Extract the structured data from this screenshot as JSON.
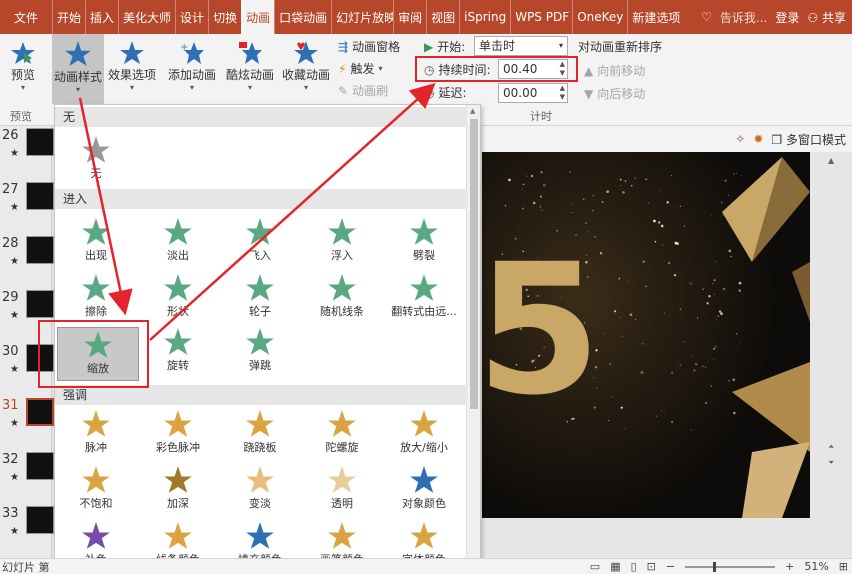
{
  "tabs": [
    "文件",
    "开始",
    "插入",
    "美化大师",
    "设计",
    "切换",
    "动画",
    "口袋动画",
    "幻灯片放映",
    "审阅",
    "视图",
    "iSpring",
    "WPS PDF",
    "OneKey",
    "新建选项"
  ],
  "active_tab": "动画",
  "tellme": "告诉我...",
  "login": "登录",
  "share": "共享",
  "ribbon": {
    "preview": "预览",
    "preview_group": "预览",
    "anim_style": "动画样式",
    "effect_options": "效果选项",
    "add_anim": "添加动画",
    "cool_anim": "酷炫动画",
    "fav_anim": "收藏动画",
    "anim_pane": "动画窗格",
    "trigger": "触发",
    "anim_brush": "动画刷",
    "start_label": "开始:",
    "start_value": "单击时",
    "duration_label": "持续时间:",
    "duration_value": "00.40",
    "delay_label": "延迟:",
    "delay_value": "00.00",
    "reorder": "对动画重新排序",
    "move_earlier": "向前移动",
    "move_later": "向后移动",
    "timing_group": "计时"
  },
  "toolstrip": {
    "multiwindow": "多窗口模式"
  },
  "dropdown": {
    "none_section": "无",
    "none_item": "无",
    "entrance_section": "进入",
    "entrance": [
      "出现",
      "淡出",
      "飞入",
      "浮入",
      "劈裂",
      "擦除",
      "形状",
      "轮子",
      "随机线条",
      "翻转式由远...",
      "缩放",
      "旋转",
      "弹跳"
    ],
    "emphasis_section": "强调",
    "emphasis": [
      "脉冲",
      "彩色脉冲",
      "跷跷板",
      "陀螺旋",
      "放大/缩小",
      "不饱和",
      "加深",
      "变淡",
      "透明",
      "对象颜色",
      "补色",
      "线条颜色",
      "填充颜色",
      "画笔颜色",
      "字体颜色"
    ]
  },
  "thumbnails": [
    "26",
    "27",
    "28",
    "29",
    "30",
    "31",
    "32",
    "33"
  ],
  "selected_slide": "31",
  "canvas_text": "5",
  "statusbar": {
    "slide": "幻灯片 第",
    "zoom": "51%"
  },
  "colors": {
    "accent": "#b7472a",
    "green": "#5aa784",
    "gold": "#d9a441",
    "red": "#e3242b"
  }
}
